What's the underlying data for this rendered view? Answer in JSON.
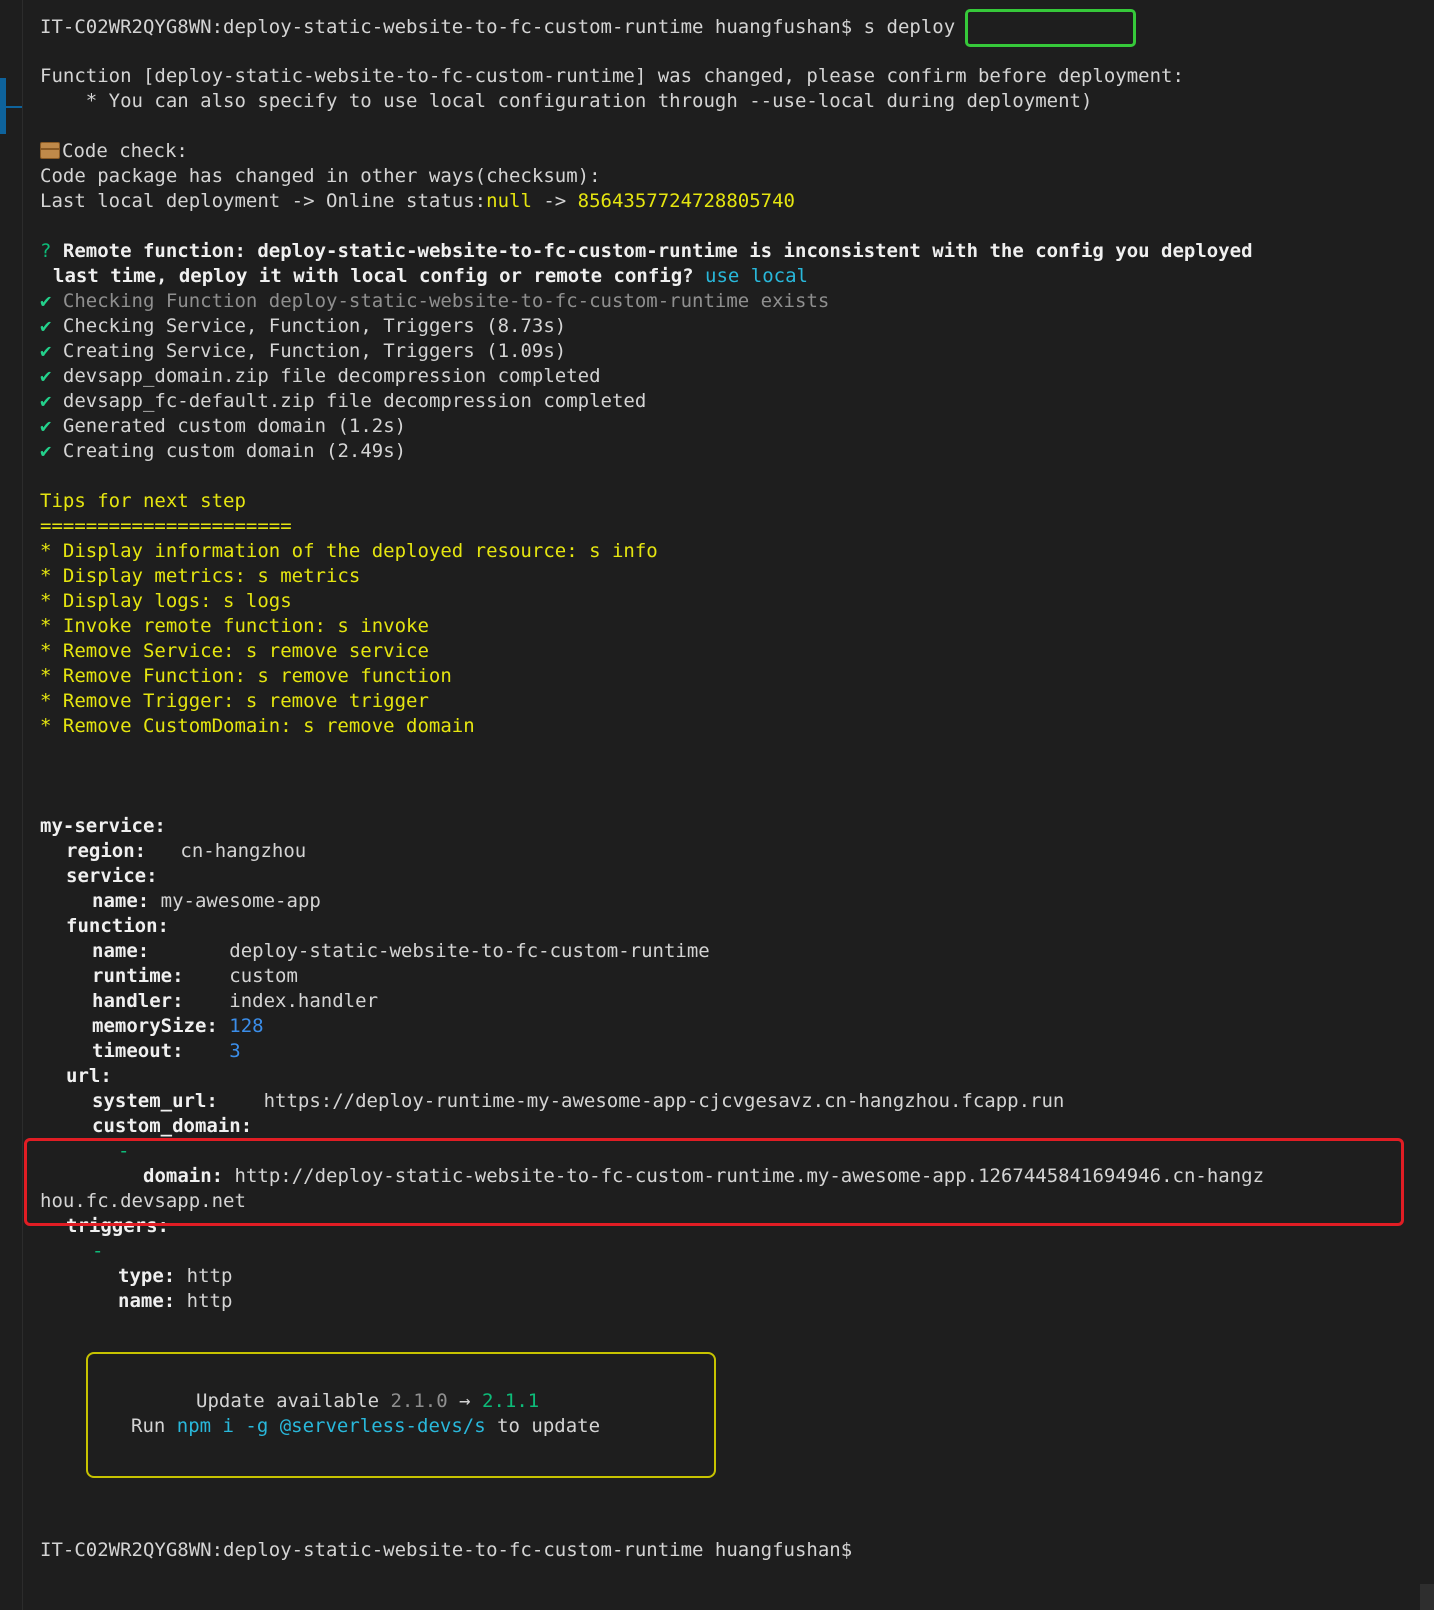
{
  "prompt": {
    "host_path": "IT-C02WR2QYG8WN:deploy-static-website-to-fc-custom-runtime huangfushan$",
    "command": "s deploy"
  },
  "changed_notice": {
    "line1": "Function [deploy-static-website-to-fc-custom-runtime] was changed, please confirm before deployment:",
    "line2": "    * You can also specify to use local configuration through --use-local during deployment)"
  },
  "code_check": {
    "title": "Code check:",
    "line1": "Code package has changed in other ways(checksum):",
    "line2_prefix": "Last local deployment -> Online status:",
    "line2_null": "null",
    "line2_arrow": " -> ",
    "line2_checksum": "8564357724728805740"
  },
  "question": {
    "mark": "?",
    "line1": "Remote function: deploy-static-website-to-fc-custom-runtime is inconsistent with the config you deployed",
    "line2": "last time, deploy it with local config or remote config?",
    "answer": "use local"
  },
  "checks": [
    {
      "mark": "✔",
      "text": "Checking Function deploy-static-website-to-fc-custom-runtime exists",
      "dim": true
    },
    {
      "mark": "✔",
      "text": "Checking Service, Function, Triggers (8.73s)",
      "dim": false
    },
    {
      "mark": "✔",
      "text": "Creating Service, Function, Triggers (1.09s)",
      "dim": false
    },
    {
      "mark": "✔",
      "text": "devsapp_domain.zip file decompression completed",
      "dim": false
    },
    {
      "mark": "✔",
      "text": "devsapp_fc-default.zip file decompression completed",
      "dim": false
    },
    {
      "mark": "✔",
      "text": "Generated custom domain (1.2s)",
      "dim": false
    },
    {
      "mark": "✔",
      "text": "Creating custom domain (2.49s)",
      "dim": false
    }
  ],
  "tips": {
    "title": "Tips for next step",
    "rule": "======================",
    "items": [
      "* Display information of the deployed resource: s info",
      "* Display metrics: s metrics",
      "* Display logs: s logs",
      "* Invoke remote function: s invoke",
      "* Remove Service: s remove service",
      "* Remove Function: s remove function",
      "* Remove Trigger: s remove trigger",
      "* Remove CustomDomain: s remove domain"
    ]
  },
  "result": {
    "root_key": "my-service",
    "region_key": "region",
    "region_value": "cn-hangzhou",
    "service_key": "service",
    "service_name_key": "name",
    "service_name_value": "my-awesome-app",
    "function_key": "function",
    "fn_name_key": "name",
    "fn_name_value": "deploy-static-website-to-fc-custom-runtime",
    "fn_runtime_key": "runtime",
    "fn_runtime_value": "custom",
    "fn_handler_key": "handler",
    "fn_handler_value": "index.handler",
    "fn_memory_key": "memorySize",
    "fn_memory_value": "128",
    "fn_timeout_key": "timeout",
    "fn_timeout_value": "3",
    "url_key": "url",
    "system_url_key": "system_url",
    "system_url_value": "https://deploy-runtime-my-awesome-app-cjcvgesavz.cn-hangzhou.fcapp.run",
    "custom_domain_key": "custom_domain",
    "dash": "-",
    "domain_key": "domain",
    "domain_value_1": "http://deploy-static-website-to-fc-custom-runtime.my-awesome-app.1267445841694946.cn-hangz",
    "domain_value_2": "hou.fc.devsapp.net",
    "triggers_key": "triggers",
    "trigger_type_key": "type",
    "trigger_type_value": "http",
    "trigger_name_key": "name",
    "trigger_name_value": "http"
  },
  "update": {
    "label": "Update available",
    "from_version": "2.1.0",
    "arrow": "→",
    "to_version": "2.1.1",
    "run_prefix": "Run",
    "command": "npm i -g @serverless-devs/s",
    "run_suffix": "to update"
  },
  "final_prompt": "IT-C02WR2QYG8WN:deploy-static-website-to-fc-custom-runtime huangfushan$",
  "colors": {
    "background": "#1e1e1e",
    "text": "#d4d4d4",
    "yellow": "#e5e510",
    "cyan": "#29b8db",
    "blue": "#3b8eea",
    "check_green": "#23d18b",
    "highlight_green": "#36c93a",
    "highlight_red": "#e11d24"
  }
}
